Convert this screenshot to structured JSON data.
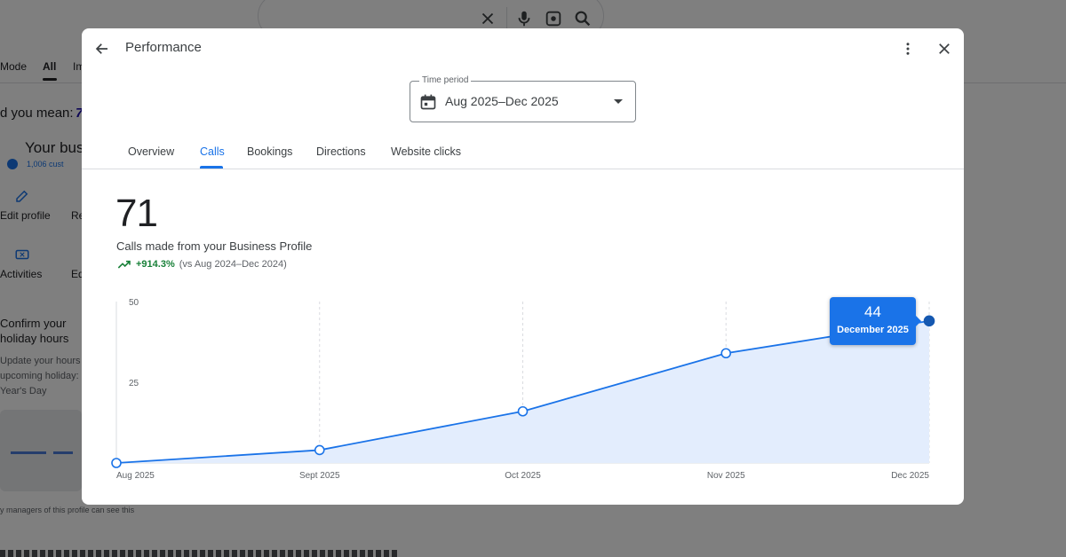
{
  "background": {
    "tabs": [
      "Mode",
      "All",
      "Im"
    ],
    "did_you_mean": "d you mean:",
    "did_you_mean_value": "7",
    "business_name": "Your bus",
    "customers": "1,006 cust",
    "edit_profile": "Edit profile",
    "edit_profile_more": "Re",
    "activities": "Activities",
    "activities_more": "Ed",
    "confirm_line1": "Confirm your",
    "confirm_line2": "holiday hours",
    "update_line1": "Update your hours",
    "update_line2": "upcoming holiday:",
    "update_line3": "Year's Day",
    "managers_note": "y managers of this profile can see this"
  },
  "modal": {
    "title": "Performance",
    "time_period_label": "Time period",
    "time_period_value": "Aug 2025–Dec 2025",
    "tabs": [
      {
        "label": "Overview",
        "active": false
      },
      {
        "label": "Calls",
        "active": true
      },
      {
        "label": "Bookings",
        "active": false
      },
      {
        "label": "Directions",
        "active": false
      },
      {
        "label": "Website clicks",
        "active": false
      }
    ],
    "metric": {
      "value": "71",
      "label": "Calls made from your Business Profile",
      "change": "+914.3%",
      "comparison": "(vs Aug 2024–Dec 2024)"
    },
    "tooltip": {
      "value": "44",
      "label": "December 2025"
    },
    "icons": [
      "back-arrow-icon",
      "calendar-icon",
      "dropdown-caret-icon",
      "more-vert-icon",
      "close-icon",
      "trending-up-icon"
    ]
  },
  "colors": {
    "accent": "#1a73e8",
    "positive": "#188038",
    "area_fill": "#e3edfd"
  },
  "chart_data": {
    "type": "area",
    "categories": [
      "Aug 2025",
      "Sept 2025",
      "Oct 2025",
      "Nov 2025",
      "Dec 2025"
    ],
    "values": [
      0,
      4,
      16,
      34,
      44
    ],
    "yticks": [
      25,
      50
    ],
    "ylim": [
      0,
      50
    ],
    "grid": "vertical dashed",
    "highlighted_index": 4
  }
}
